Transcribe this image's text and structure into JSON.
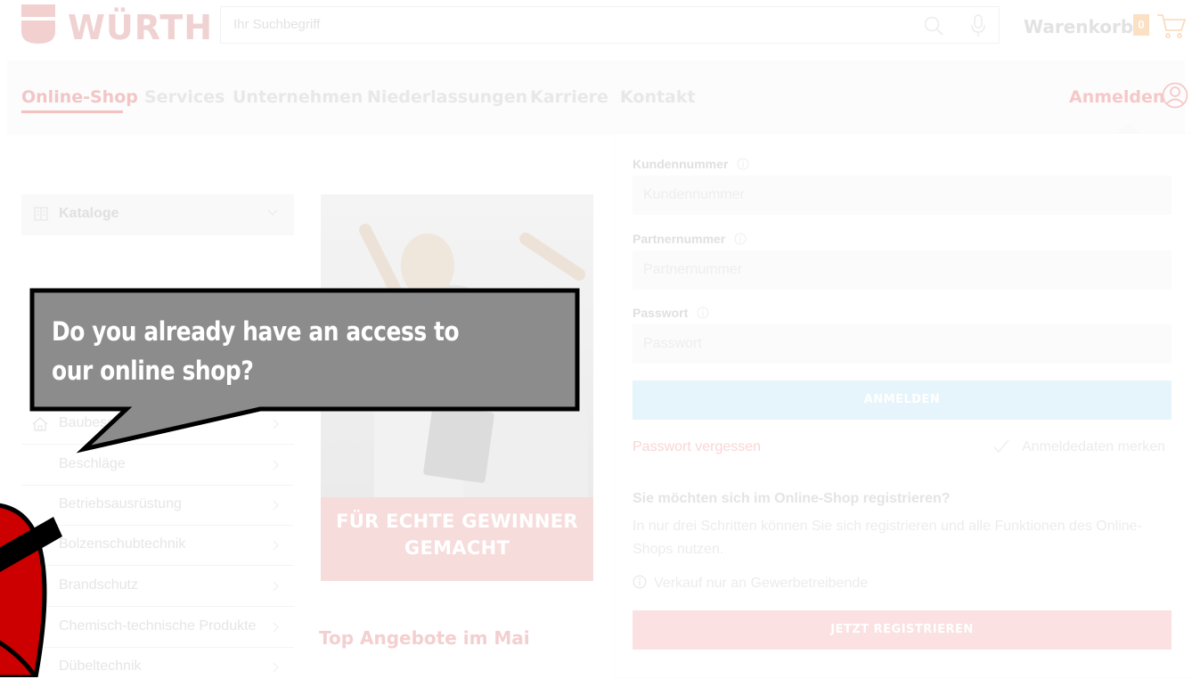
{
  "header": {
    "brand": "WÜRTH",
    "search_placeholder": "Ihr Suchbegriff",
    "cart_label": "Warenkorb",
    "cart_count": "0"
  },
  "nav": {
    "items": [
      "Online-Shop",
      "Services",
      "Unternehmen",
      "Niederlassungen",
      "Karriere",
      "Kontakt"
    ],
    "login_label": "Anmelden"
  },
  "sidebar": {
    "catalog_label": "Kataloge",
    "categories": [
      "Baubeschlag",
      "Beschläge",
      "Betriebsausrüstung",
      "Bolzenschubtechnik",
      "Brandschutz",
      "Chemisch-technische Produkte",
      "Dübeltechnik"
    ]
  },
  "promo": {
    "line1": "FÜR ECHTE GEWINNER",
    "line2": "GEMACHT",
    "section_title": "Top Angebote im Mai"
  },
  "login_form": {
    "customer_number_label": "Kundennummer",
    "customer_number_placeholder": "Kundennummer",
    "partner_number_label": "Partnernummer",
    "partner_number_placeholder": "Partnernummer",
    "password_label": "Passwort",
    "password_placeholder": "Passwort",
    "login_button": "ANMELDEN",
    "forgot_password": "Passwort vergessen",
    "remember_label": "Anmeldedaten merken",
    "register_heading": "Sie möchten sich im Online-Shop registrieren?",
    "register_text": "In nur drei Schritten können Sie sich registrieren und alle Funktionen des Online-Shops nutzen.",
    "sale_note": "Verkauf nur an Gewerbetreibende",
    "register_button": "JETZT REGISTRIEREN"
  },
  "overlay": {
    "question": "Do you already have an access to our online shop?"
  },
  "colors": {
    "brand_red": "#cc0000",
    "bubble_fill": "#8c8c8c"
  }
}
